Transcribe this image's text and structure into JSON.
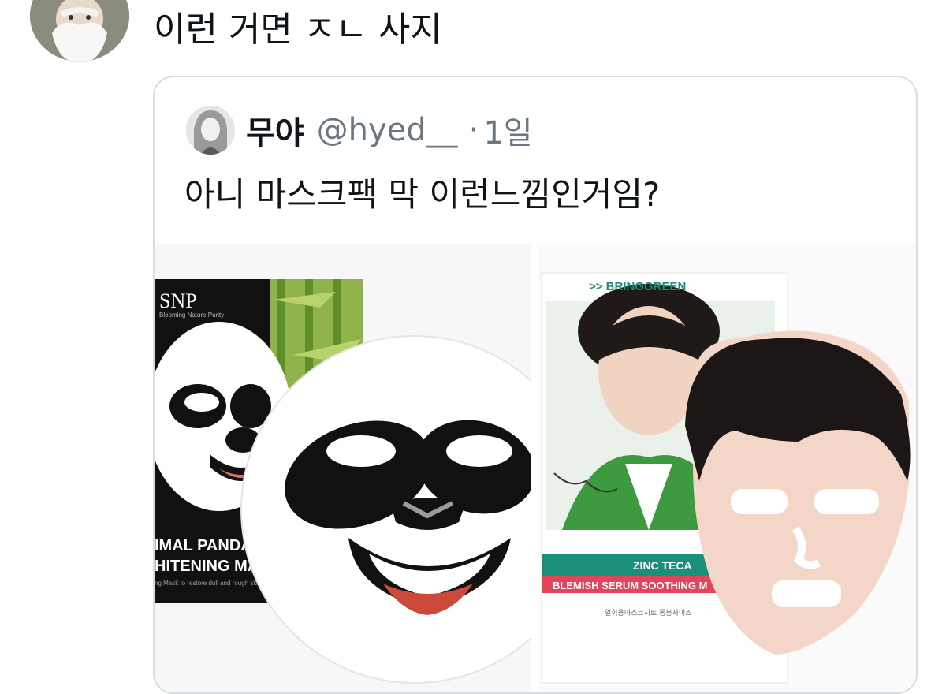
{
  "tweet": {
    "text": "이런 거면 ㅈㄴ 사지"
  },
  "quote": {
    "display_name": "무야",
    "handle": "@hyed__",
    "separator": "·",
    "time": "1일",
    "text": "아니 마스크팩 막 이런느낌인거임?"
  },
  "media": {
    "left": {
      "brand": "SNP",
      "brand_sub": "Blooming Nature Purity",
      "line1": "IMAL PANDA",
      "line2": "HITENING MASK",
      "desc": "ng Mask to restore dull and rough skin with"
    },
    "right": {
      "brand": ">> BRINGGREEN",
      "product_line1": "ZINC TECA",
      "product_line2": "BLEMISH SERUM SOOTHING M",
      "fine_print": "일회용마스크시트 동봉사이즈"
    }
  },
  "colors": {
    "handle_gray": "#6b7680",
    "card_border": "#d8dde1",
    "bamboo_green": "#7da93b",
    "teal_label": "#1a8f7a",
    "red_label": "#e2455a"
  }
}
